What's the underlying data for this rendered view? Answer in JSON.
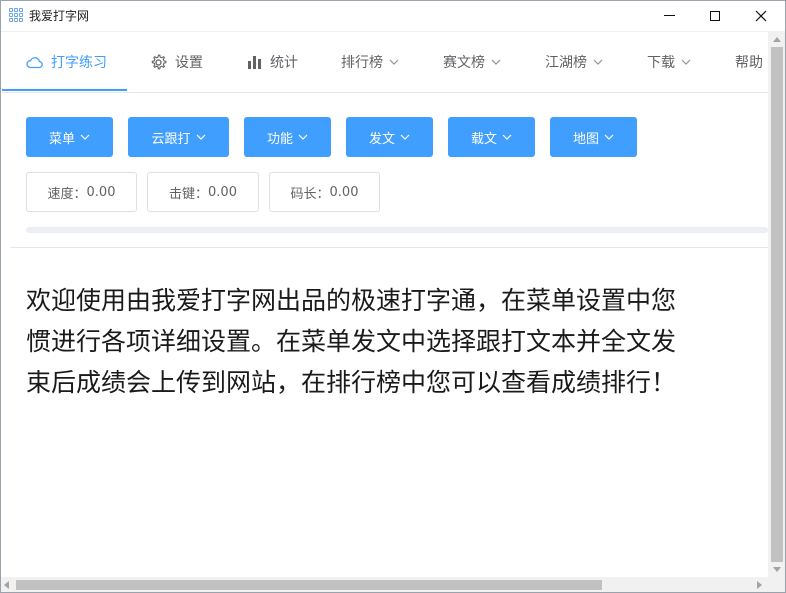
{
  "window": {
    "title": "我爱打字网",
    "icon": "grid-app-icon",
    "controls": [
      "minimize-icon",
      "maximize-icon",
      "close-icon"
    ]
  },
  "tabs": [
    {
      "label": "打字练习",
      "icon": "cloud-icon",
      "active": true
    },
    {
      "label": "设置",
      "icon": "gear-icon"
    },
    {
      "label": "统计",
      "icon": "bar-chart-icon"
    },
    {
      "label": "排行榜",
      "dropdown": true
    },
    {
      "label": "赛文榜",
      "dropdown": true
    },
    {
      "label": "江湖榜",
      "dropdown": true
    },
    {
      "label": "下载",
      "dropdown": true
    },
    {
      "label": "帮助"
    }
  ],
  "toolbar": {
    "buttons": [
      "菜单",
      "云跟打",
      "功能",
      "发文",
      "载文",
      "地图"
    ]
  },
  "stats": [
    {
      "label": "速度：",
      "value": "0.00"
    },
    {
      "label": "击键：",
      "value": "0.00"
    },
    {
      "label": "码长：",
      "value": "0.00"
    }
  ],
  "progress": {
    "value": 0
  },
  "content": {
    "lines": [
      "欢迎使用由我爱打字网出品的极速打字通，在菜单设置中您",
      "惯进行各项详细设置。在菜单发文中选择跟打文本并全文发",
      "束后成绩会上传到网站，在排行榜中您可以查看成绩排行！"
    ]
  },
  "colors": {
    "accent": "#409eff",
    "text": "#303133",
    "muted": "#606266",
    "border": "#dcdfe6"
  }
}
